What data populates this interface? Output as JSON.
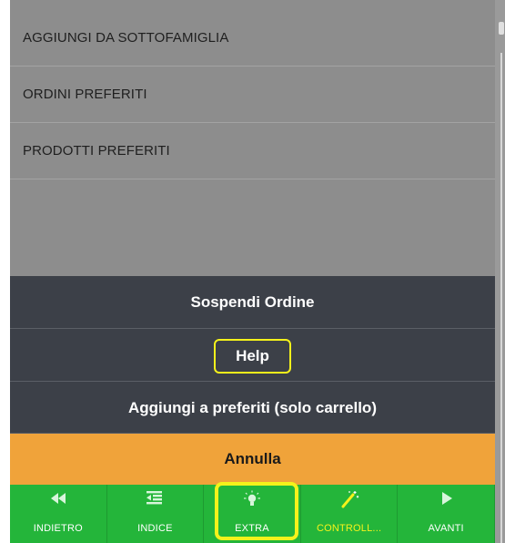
{
  "list": {
    "items": [
      {
        "label": "AGGIUNGI DA SOTTOFAMIGLIA"
      },
      {
        "label": "ORDINI PREFERITI"
      },
      {
        "label": "PRODOTTI PREFERITI"
      }
    ]
  },
  "action_sheet": {
    "suspend_label": "Sospendi Ordine",
    "help_label": "Help",
    "add_favorites_label": "Aggiungi a preferiti (solo carrello)",
    "cancel_label": "Annulla"
  },
  "tabbar": {
    "tabs": [
      {
        "label": "INDIETRO",
        "icon": "rewind-icon"
      },
      {
        "label": "INDICE",
        "icon": "list-indent-icon"
      },
      {
        "label": "EXTRA",
        "icon": "lightbulb-icon"
      },
      {
        "label": "CONTROLL...",
        "icon": "magic-wand-icon"
      },
      {
        "label": "AVANTI",
        "icon": "play-forward-icon"
      }
    ],
    "active_label_color": "#f5f21b"
  },
  "colors": {
    "tabbar_bg": "#24b53a",
    "action_bg": "#3c4048",
    "cancel_bg": "#f0a33a",
    "highlight": "#f5f21b",
    "list_bg": "#8d8d8d"
  }
}
